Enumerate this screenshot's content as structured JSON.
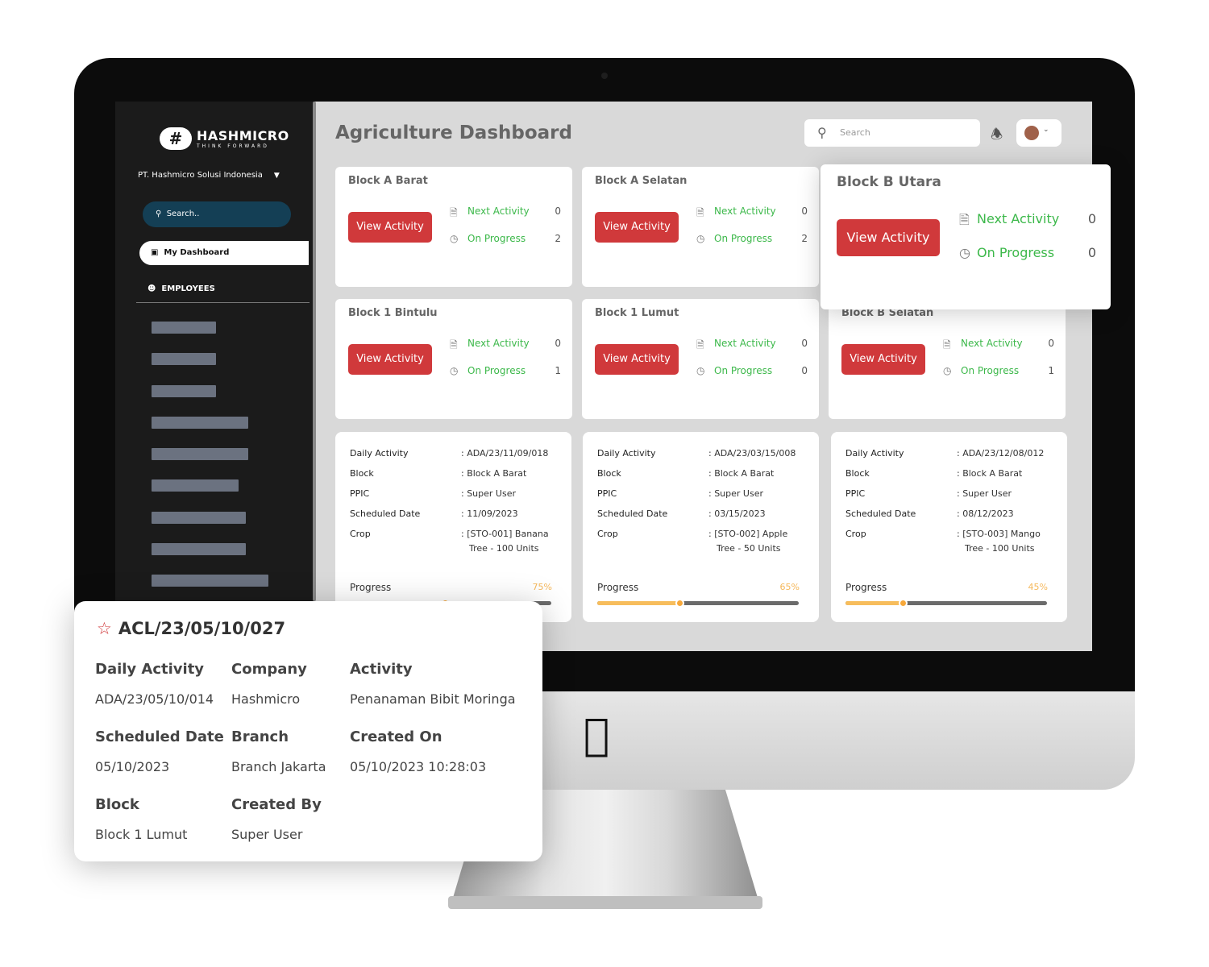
{
  "brand": {
    "name": "HASHMICRO",
    "tagline": "THINK FORWARD"
  },
  "sidebar": {
    "company": "PT. Hashmicro Solusi Indonesia",
    "search_placeholder": "Search..",
    "active_item": "My Dashboard",
    "section": "EMPLOYEES"
  },
  "header": {
    "title": "Agriculture Dashboard",
    "search_placeholder": "Search"
  },
  "labels": {
    "view_activity": "View Activity",
    "next_activity": "Next Activity",
    "on_progress": "On Progress",
    "daily_activity": "Daily Activity",
    "block": "Block",
    "ppic": "PPIC",
    "scheduled_date": "Scheduled Date",
    "crop": "Crop",
    "progress": "Progress"
  },
  "blocks": [
    {
      "name": "Block A Barat",
      "next": "0",
      "progress": "2"
    },
    {
      "name": "Block A Selatan",
      "next": "0",
      "progress": "2"
    },
    {
      "name": "Block B Utara",
      "next": "0",
      "progress": "0"
    },
    {
      "name": "Block 1 Bintulu",
      "next": "0",
      "progress": "1"
    },
    {
      "name": "Block 1 Lumut",
      "next": "0",
      "progress": "0"
    },
    {
      "name": "Block B Selatan",
      "next": "0",
      "progress": "1"
    }
  ],
  "activities": [
    {
      "daily_activity": "ADA/23/11/09/018",
      "block": "Block A Barat",
      "ppic": "Super User",
      "scheduled_date": "11/09/2023",
      "crop_line1": "[STO-001] Banana",
      "crop_line2": "Tree - 100 Units",
      "progress": 75,
      "progress_label": "75%"
    },
    {
      "daily_activity": "ADA/23/03/15/008",
      "block": "Block A Barat",
      "ppic": "Super User",
      "scheduled_date": "03/15/2023",
      "crop_line1": "[STO-002] Apple",
      "crop_line2": "Tree - 50 Units",
      "progress": 65,
      "progress_label": "65%"
    },
    {
      "daily_activity": "ADA/23/12/08/012",
      "block": "Block A Barat",
      "ppic": "Super User",
      "scheduled_date": "08/12/2023",
      "crop_line1": "[STO-003] Mango",
      "crop_line2": "Tree - 100 Units",
      "progress": 45,
      "progress_label": "45%"
    }
  ],
  "popup": {
    "title": "ACL/23/05/10/027",
    "fields": [
      {
        "label": "Daily Activity",
        "value": "ADA/23/05/10/014"
      },
      {
        "label": "Company",
        "value": "Hashmicro"
      },
      {
        "label": "Activity",
        "value": "Penanaman Bibit Moringa"
      },
      {
        "label": "Scheduled Date",
        "value": "05/10/2023"
      },
      {
        "label": "Branch",
        "value": "Branch Jakarta"
      },
      {
        "label": "Created On",
        "value": "05/10/2023 10:28:03"
      },
      {
        "label": "Block",
        "value": "Block 1 Lumut"
      },
      {
        "label": "Created By",
        "value": "Super User"
      }
    ]
  },
  "colors": {
    "accent_red": "#d0393b",
    "status_green": "#3cb84a",
    "progress_orange": "#f7bd5c",
    "sidebar_bg": "#1b1b1b",
    "search_bg": "#143f55"
  }
}
